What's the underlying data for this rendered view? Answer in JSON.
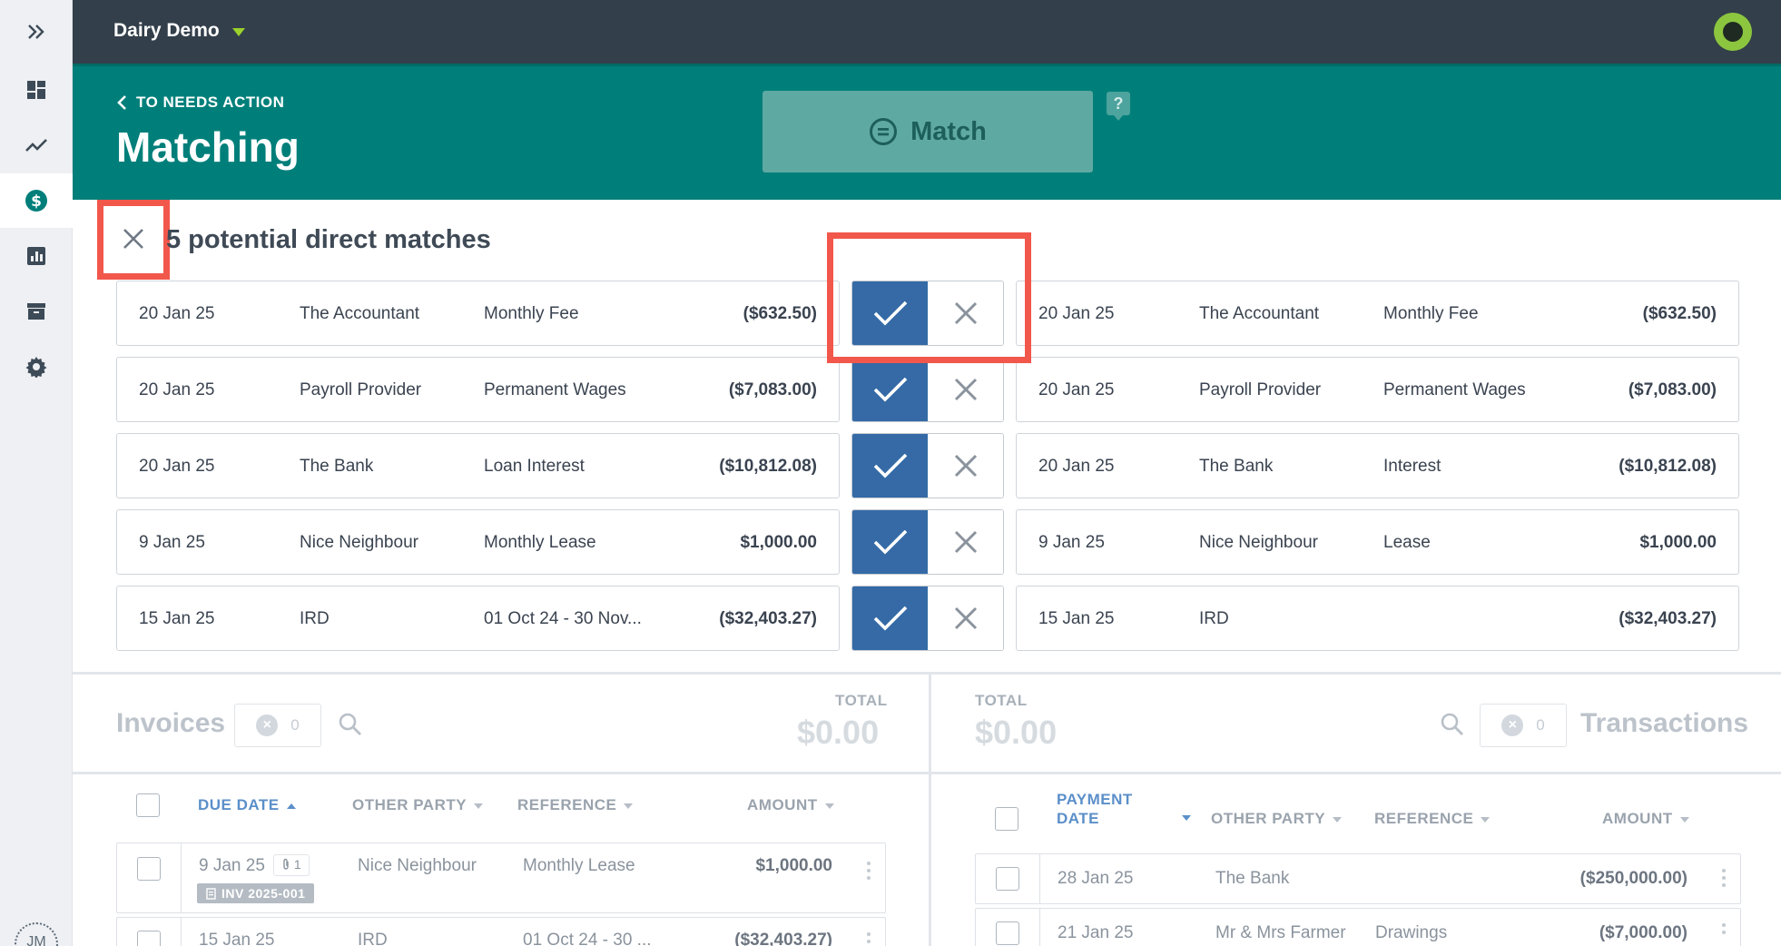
{
  "topbar": {
    "org_name": "Dairy Demo"
  },
  "hero": {
    "back_label": "TO NEEDS ACTION",
    "title": "Matching",
    "match_label": "Match",
    "help_label": "?"
  },
  "matches": {
    "title": "5 potential direct matches",
    "rows": [
      {
        "left": [
          "20 Jan 25",
          "The Accountant",
          "Monthly Fee",
          "($632.50)"
        ],
        "right": [
          "20 Jan 25",
          "The Accountant",
          "Monthly Fee",
          "($632.50)"
        ]
      },
      {
        "left": [
          "20 Jan 25",
          "Payroll Provider",
          "Permanent Wages",
          "($7,083.00)"
        ],
        "right": [
          "20 Jan 25",
          "Payroll Provider",
          "Permanent Wages",
          "($7,083.00)"
        ]
      },
      {
        "left": [
          "20 Jan 25",
          "The Bank",
          "Loan Interest",
          "($10,812.08)"
        ],
        "right": [
          "20 Jan 25",
          "The Bank",
          "Interest",
          "($10,812.08)"
        ]
      },
      {
        "left": [
          "9 Jan 25",
          "Nice Neighbour",
          "Monthly Lease",
          "$1,000.00"
        ],
        "right": [
          "9 Jan 25",
          "Nice Neighbour",
          "Lease",
          "$1,000.00"
        ]
      },
      {
        "left": [
          "15 Jan 25",
          "IRD",
          "01 Oct 24 - 30 Nov...",
          "($32,403.27)"
        ],
        "right": [
          "15 Jan 25",
          "IRD",
          "",
          "($32,403.27)"
        ]
      }
    ]
  },
  "invoices": {
    "title": "Invoices",
    "count": "0",
    "total_label": "TOTAL",
    "total_value": "$0.00",
    "columns": [
      "DUE DATE",
      "OTHER PARTY",
      "REFERENCE",
      "AMOUNT"
    ],
    "rows": [
      {
        "date": "9 Jan 25",
        "attachments": "1",
        "badge": "INV 2025-001",
        "party": "Nice Neighbour",
        "reference": "Monthly Lease",
        "amount": "$1,000.00"
      },
      {
        "date": "15 Jan 25",
        "party": "IRD",
        "reference": "01 Oct 24 - 30 ...",
        "amount": "($32,403.27)"
      }
    ]
  },
  "transactions": {
    "title": "Transactions",
    "count": "0",
    "total_label": "TOTAL",
    "total_value": "$0.00",
    "columns": [
      "PAYMENT",
      "DATE",
      "OTHER PARTY",
      "REFERENCE",
      "AMOUNT"
    ],
    "rows": [
      {
        "date": "28 Jan 25",
        "party": "The Bank",
        "reference": "",
        "amount": "($250,000.00)"
      },
      {
        "date": "21 Jan 25",
        "party": "Mr & Mrs Farmer",
        "reference": "Drawings",
        "amount": "($7,000.00)"
      }
    ]
  },
  "user": {
    "initials": "JM"
  },
  "colors": {
    "teal": "#007f7a",
    "topbar": "#333f4a",
    "accept_blue": "#356aa6",
    "highlight": "#f2574b",
    "logo_green": "#8cc63f"
  }
}
